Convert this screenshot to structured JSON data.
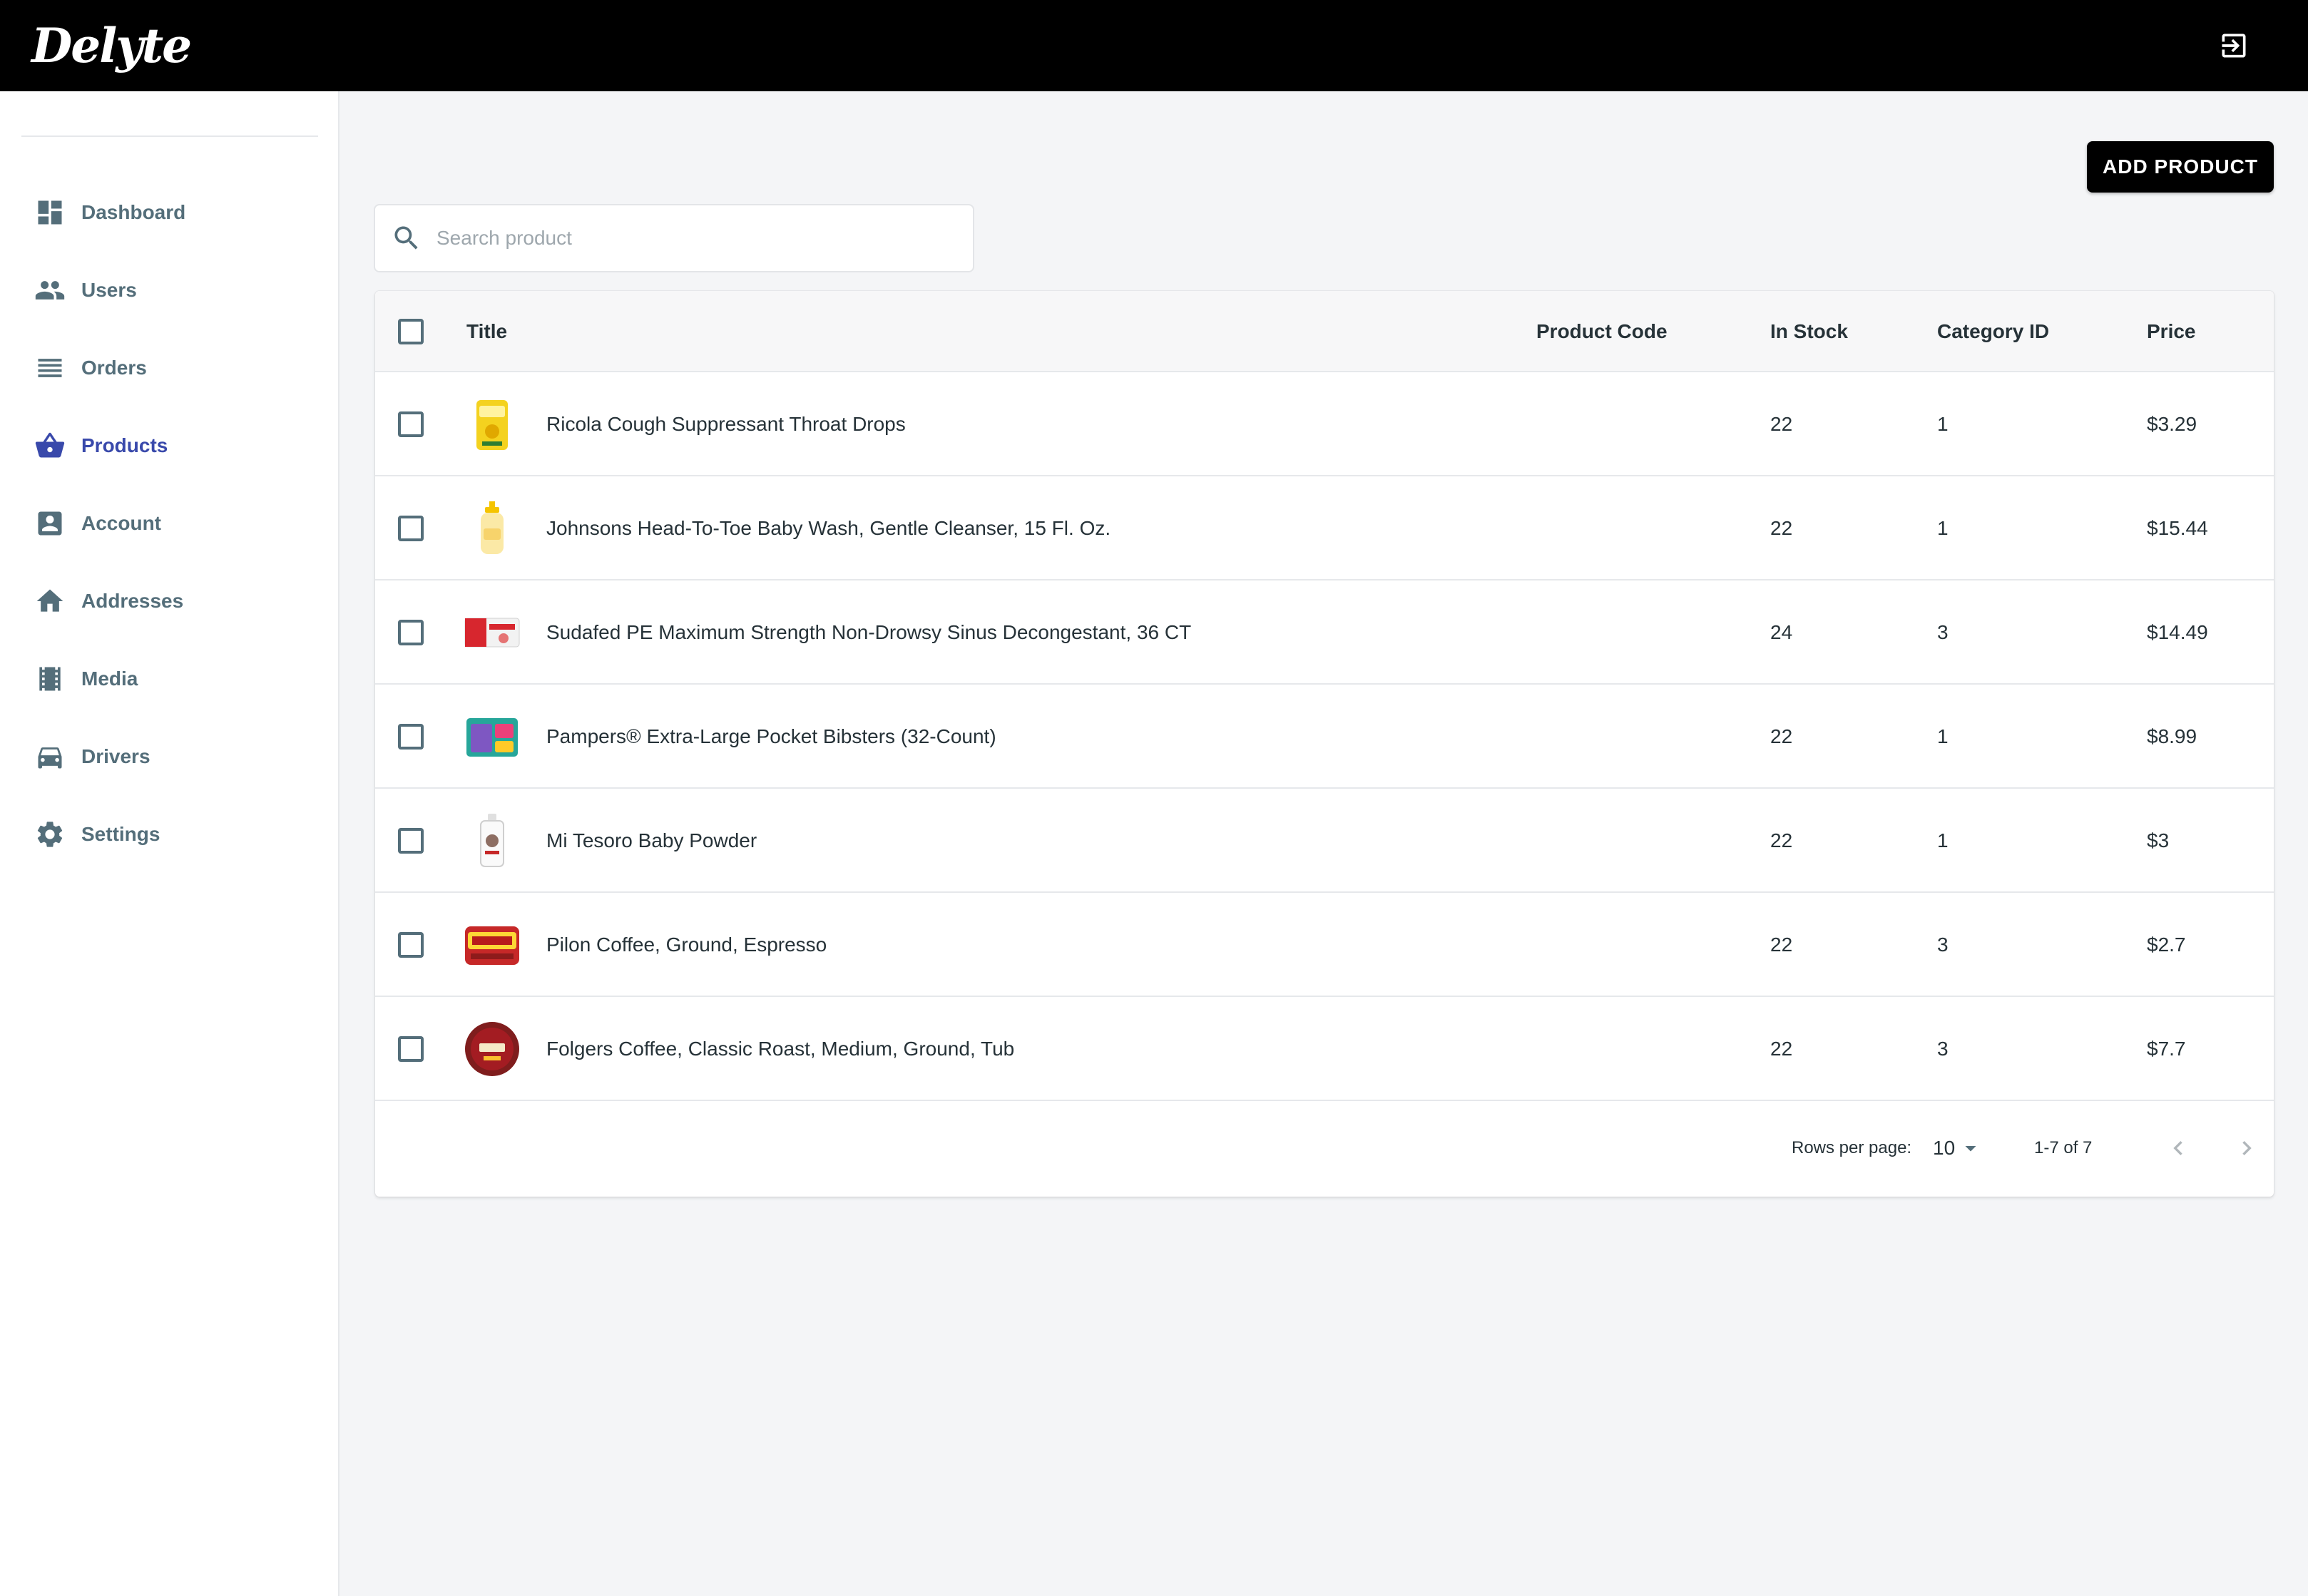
{
  "app": {
    "logo": "Delyte"
  },
  "sidebar": {
    "items": [
      {
        "label": "Dashboard",
        "icon": "dashboard-icon"
      },
      {
        "label": "Users",
        "icon": "users-icon"
      },
      {
        "label": "Orders",
        "icon": "orders-icon"
      },
      {
        "label": "Products",
        "icon": "basket-icon",
        "active": true
      },
      {
        "label": "Account",
        "icon": "account-icon"
      },
      {
        "label": "Addresses",
        "icon": "home-icon"
      },
      {
        "label": "Media",
        "icon": "film-icon"
      },
      {
        "label": "Drivers",
        "icon": "car-icon"
      },
      {
        "label": "Settings",
        "icon": "gear-icon"
      }
    ]
  },
  "toolbar": {
    "add_label": "ADD PRODUCT"
  },
  "search": {
    "placeholder": "Search product"
  },
  "table": {
    "columns": [
      "Title",
      "Product Code",
      "In Stock",
      "Category ID",
      "Price"
    ],
    "rows": [
      {
        "title": "Ricola Cough Suppressant Throat Drops",
        "code": "",
        "stock": "22",
        "category": "1",
        "price": "$3.29"
      },
      {
        "title": "Johnsons Head-To-Toe Baby Wash, Gentle Cleanser, 15 Fl. Oz.",
        "code": "",
        "stock": "22",
        "category": "1",
        "price": "$15.44"
      },
      {
        "title": "Sudafed PE Maximum Strength Non-Drowsy Sinus Decongestant, 36 CT",
        "code": "",
        "stock": "24",
        "category": "3",
        "price": "$14.49"
      },
      {
        "title": "Pampers® Extra-Large Pocket Bibsters (32-Count)",
        "code": "",
        "stock": "22",
        "category": "1",
        "price": "$8.99"
      },
      {
        "title": "Mi Tesoro Baby Powder",
        "code": "",
        "stock": "22",
        "category": "1",
        "price": "$3"
      },
      {
        "title": "Pilon Coffee, Ground, Espresso",
        "code": "",
        "stock": "22",
        "category": "3",
        "price": "$2.7"
      },
      {
        "title": "Folgers Coffee, Classic Roast, Medium, Ground, Tub",
        "code": "",
        "stock": "22",
        "category": "3",
        "price": "$7.7"
      }
    ]
  },
  "pagination": {
    "rows_per_page_label": "Rows per page:",
    "rows_per_page_value": "10",
    "range": "1-7 of 7"
  },
  "colors": {
    "accent": "#3949ab",
    "topbar": "#000000",
    "nav_text": "#546e7a"
  }
}
